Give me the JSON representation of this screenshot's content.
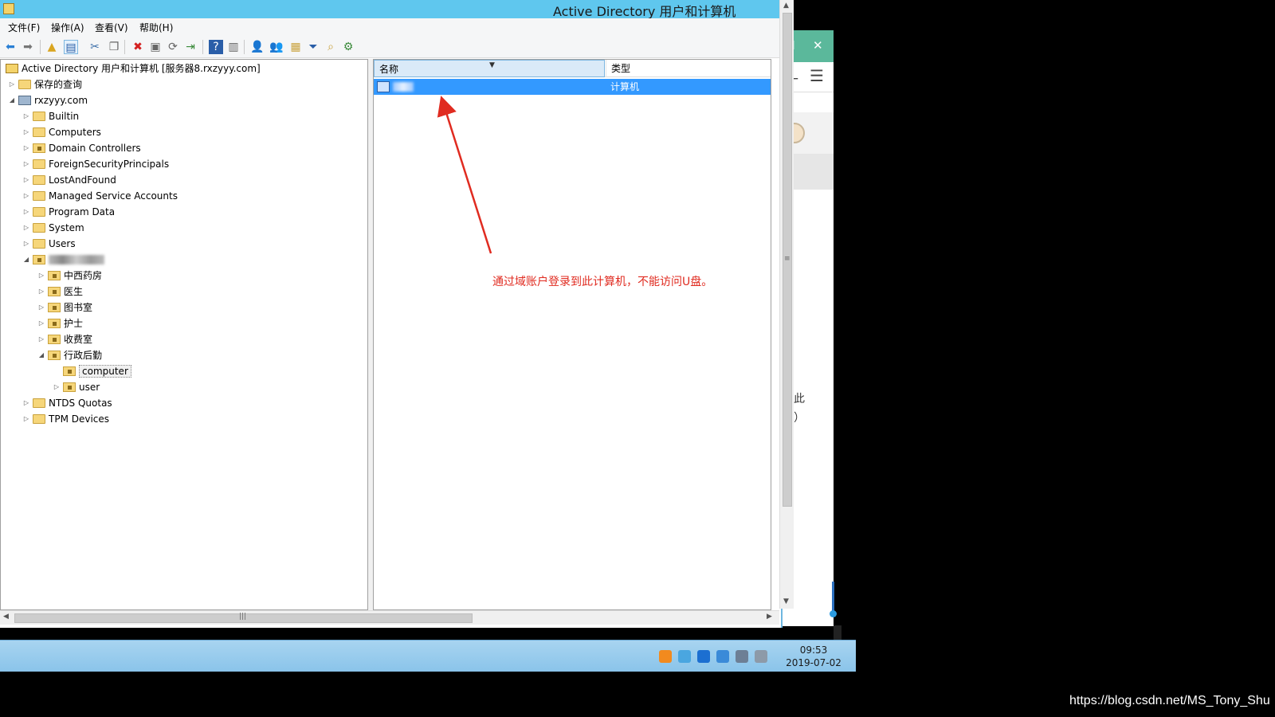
{
  "window": {
    "title": "Active Directory 用户和计算机"
  },
  "menu": [
    "文件(F)",
    "操作(A)",
    "查看(V)",
    "帮助(H)"
  ],
  "tree": {
    "root": "Active Directory 用户和计算机 [服务器8.rxzyyy.com]",
    "saved_queries": "保存的查询",
    "domain": "rxzyyy.com",
    "containers": [
      "Builtin",
      "Computers",
      "Domain Controllers",
      "ForeignSecurityPrincipals",
      "LostAndFound",
      "Managed Service Accounts",
      "Program Data",
      "System",
      "Users"
    ],
    "child_ous": [
      "中西药房",
      "医生",
      "图书室",
      "护士",
      "收费室",
      "行政后勤"
    ],
    "leaf_ous": [
      "computer",
      "user"
    ],
    "bottom_containers": [
      "NTDS Quotas",
      "TPM Devices"
    ]
  },
  "list": {
    "headers": [
      "名称",
      "类型"
    ],
    "rows": [
      {
        "type": "计算机"
      }
    ]
  },
  "annotation": "通过域账户登录到此计算机，不能访问U盘。",
  "background_window": {
    "fragments": [
      "录此",
      "楚）"
    ]
  },
  "taskbar": {
    "time": "09:53",
    "date": "2019-07-02"
  },
  "watermark": "https://blog.csdn.net/MS_Tony_Shu",
  "colors": {
    "titlebar": "#5fc7ee",
    "selection": "#3399ff",
    "annotation": "#e02b20"
  }
}
